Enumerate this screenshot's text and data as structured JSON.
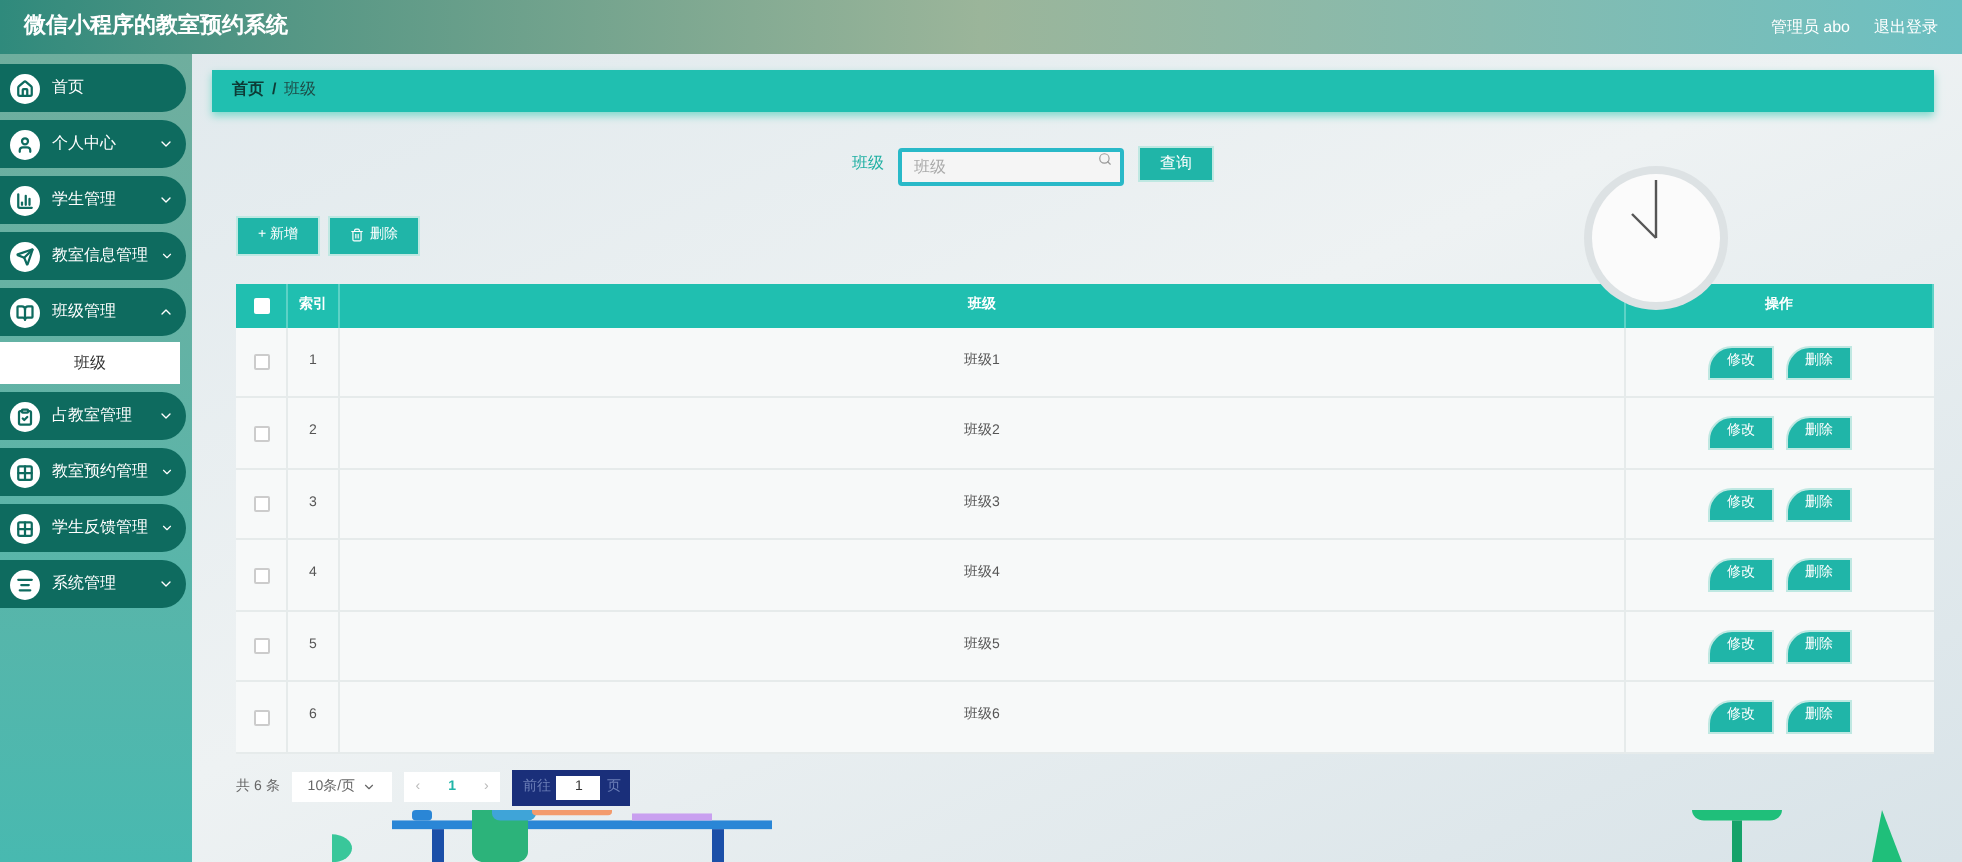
{
  "header": {
    "title": "微信小程序的教室预约系统",
    "user": "管理员 abo",
    "logout": "退出登录"
  },
  "sidebar": {
    "items": [
      {
        "kind": "link",
        "label": "首页"
      },
      {
        "kind": "group",
        "label": "个人中心",
        "expanded": false
      },
      {
        "kind": "group",
        "label": "学生管理",
        "expanded": false
      },
      {
        "kind": "group",
        "label": "教室信息管理",
        "expanded": false
      },
      {
        "kind": "group",
        "label": "班级管理",
        "expanded": true,
        "children": [
          {
            "label": "班级",
            "selected": true
          }
        ]
      },
      {
        "kind": "group",
        "label": "占教室管理",
        "expanded": false
      },
      {
        "kind": "group",
        "label": "教室预约管理",
        "expanded": false
      },
      {
        "kind": "group",
        "label": "学生反馈管理",
        "expanded": false
      },
      {
        "kind": "group",
        "label": "系统管理",
        "expanded": false
      }
    ]
  },
  "breadcrumb": [
    "首页",
    "/",
    "班级"
  ],
  "search": {
    "label": "班级",
    "placeholder": "班级",
    "button": "查询"
  },
  "actions": [
    "+ 新增",
    "删除"
  ],
  "table": {
    "all_checked": false,
    "columns": [
      "索引",
      "班级",
      "操作"
    ],
    "rows": [
      {
        "checked": false,
        "index": "1",
        "name": "班级1",
        "buttons": [
          "修改",
          "删除"
        ]
      },
      {
        "checked": false,
        "index": "2",
        "name": "班级2",
        "buttons": [
          "修改",
          "删除"
        ]
      },
      {
        "checked": false,
        "index": "3",
        "name": "班级3",
        "buttons": [
          "修改",
          "删除"
        ]
      },
      {
        "checked": false,
        "index": "4",
        "name": "班级4",
        "buttons": [
          "修改",
          "删除"
        ]
      },
      {
        "checked": false,
        "index": "5",
        "name": "班级5",
        "buttons": [
          "修改",
          "删除"
        ]
      },
      {
        "checked": false,
        "index": "6",
        "name": "班级6",
        "buttons": [
          "修改",
          "删除"
        ]
      }
    ]
  },
  "pagination": {
    "total": "共 6 条",
    "page_size": "10条/页",
    "prev": "‹",
    "page": "1",
    "next": "›",
    "goto": "前往",
    "goto_value": "1",
    "goto_suffix": "页"
  }
}
